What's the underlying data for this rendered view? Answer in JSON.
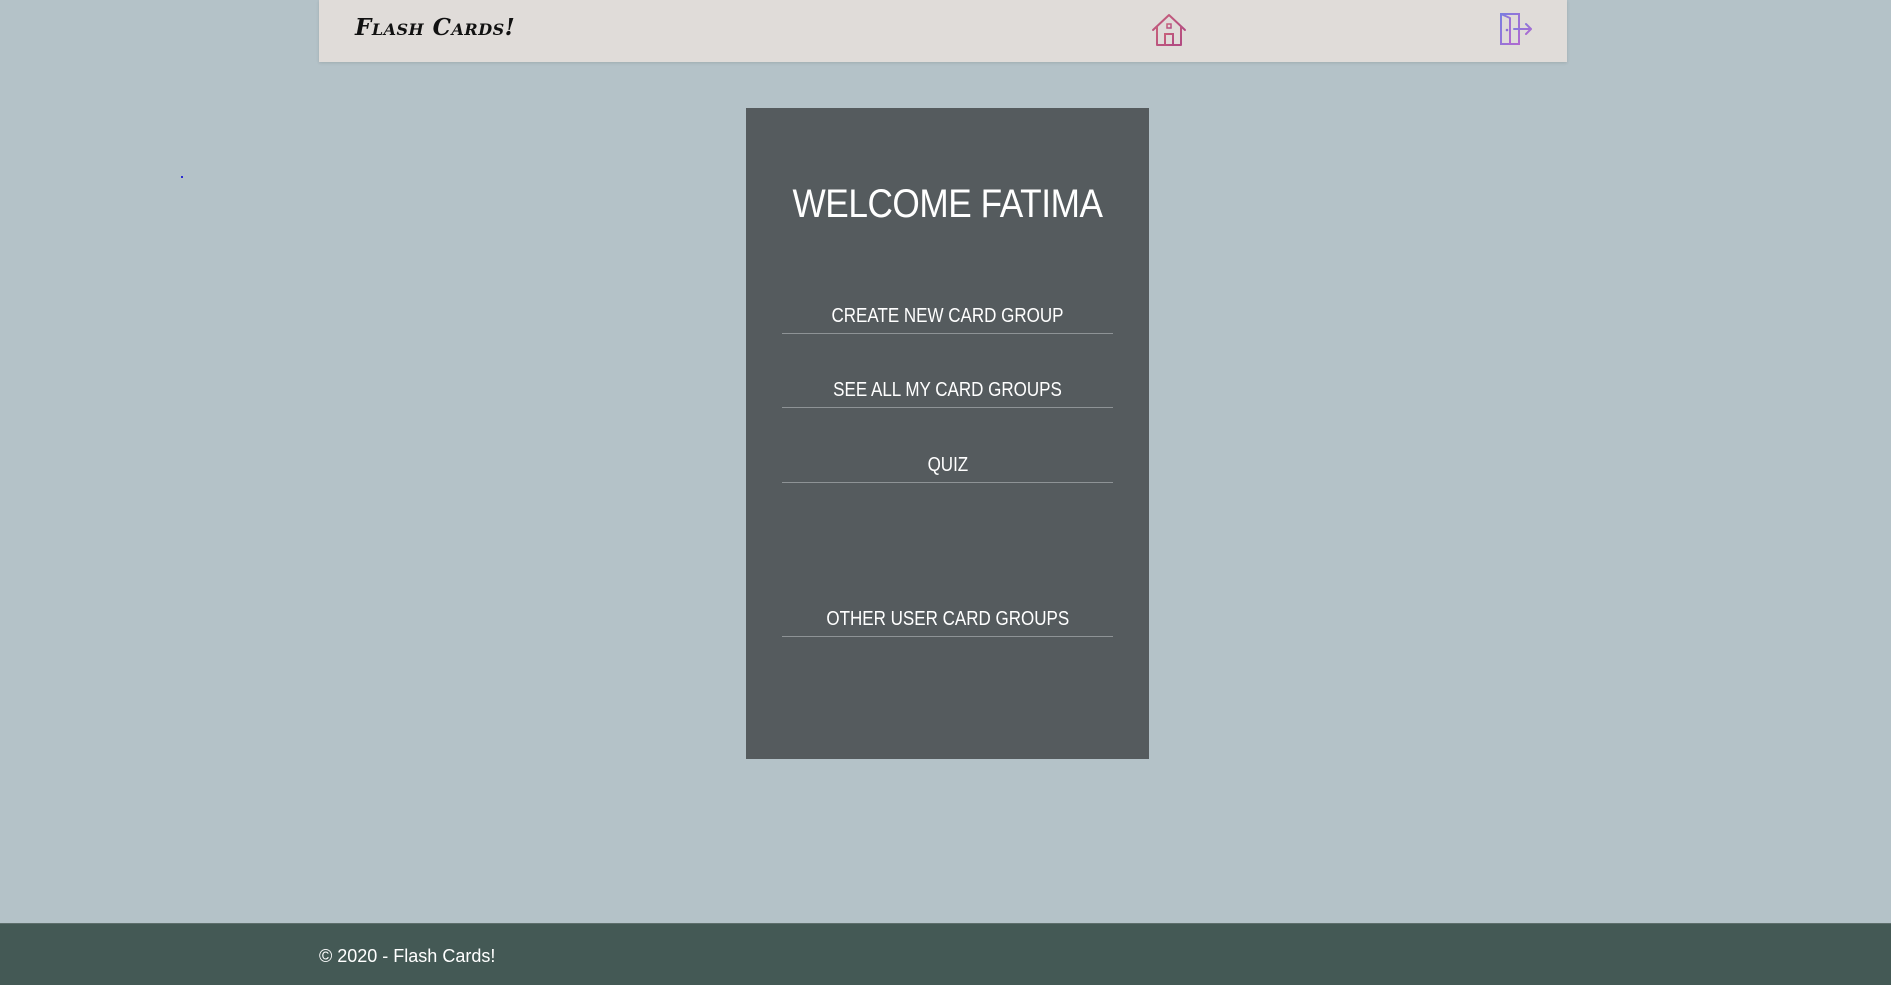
{
  "header": {
    "brand": "Flash Cards!",
    "home_icon": "home-icon",
    "logout_icon": "logout-door-icon"
  },
  "main": {
    "welcome": "WELCOME FATIMA",
    "links": [
      "CREATE NEW CARD GROUP",
      "SEE ALL MY CARD GROUPS",
      "QUIZ",
      "OTHER USER CARD GROUPS"
    ]
  },
  "footer": {
    "text": "© 2020 - Flash Cards!"
  },
  "colors": {
    "page_bg": "#b4c2c8",
    "navbar_bg": "#e0dcd9",
    "panel_bg": "#555b5e",
    "footer_bg": "#445955",
    "home_icon_color": "#c0506e",
    "logout_icon_color": "#9a6fd6"
  }
}
